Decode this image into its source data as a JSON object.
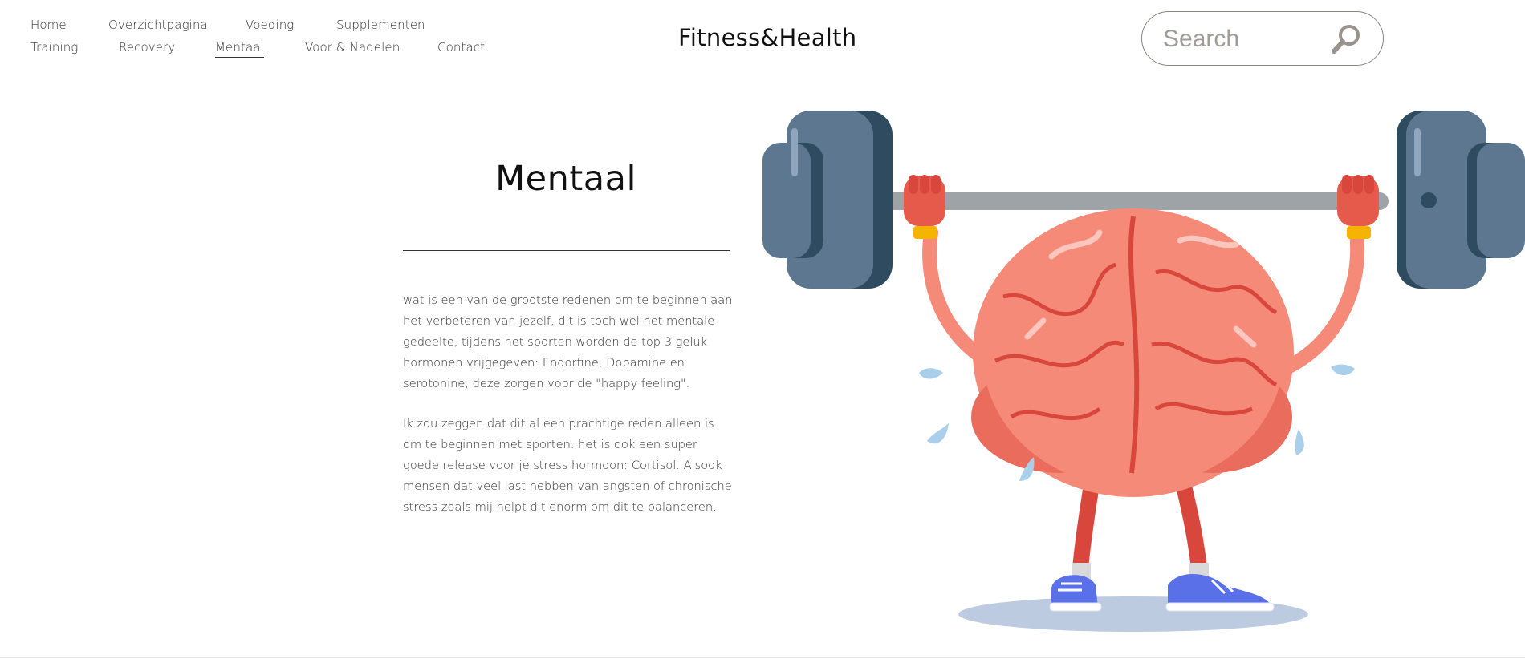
{
  "nav": {
    "row1": [
      "Home",
      "Overzichtpagina",
      "Voeding",
      "Supplementen"
    ],
    "row2": [
      "Training",
      "Recovery",
      "Mentaal",
      "Voor & Nadelen",
      "Contact"
    ],
    "active": "Mentaal"
  },
  "brand": "Fitness&Health",
  "search": {
    "placeholder": "Search",
    "icon": "search-icon"
  },
  "content": {
    "title": "Mentaal",
    "paragraphs": [
      "wat is een van de grootste redenen om te beginnen aan het verbeteren van jezelf, dit is toch wel het mentale gedeelte, tijdens het sporten worden de top 3 geluk hormonen vrijgegeven: Endorfine, Dopamine en serotonine, deze zorgen voor de \"happy feeling\".",
      "Ik zou zeggen dat dit al een prachtige reden alleen is om te beginnen met sporten. het is ook een super goede release voor je stress hormoon: Cortisol. Alsook mensen dat veel last hebben van angsten of chronische stress zoals mij helpt dit enorm om dit te balanceren."
    ]
  },
  "colors": {
    "brain": "#f58a78",
    "brain_dark": "#d9473c",
    "plate": "#5d7791",
    "plate_dark": "#2f4b60",
    "bar": "#9ea3a8",
    "shoe": "#5a70e8",
    "shadow": "#bccbe0",
    "sweat": "#a9cfea",
    "wristband": "#f4b400"
  }
}
